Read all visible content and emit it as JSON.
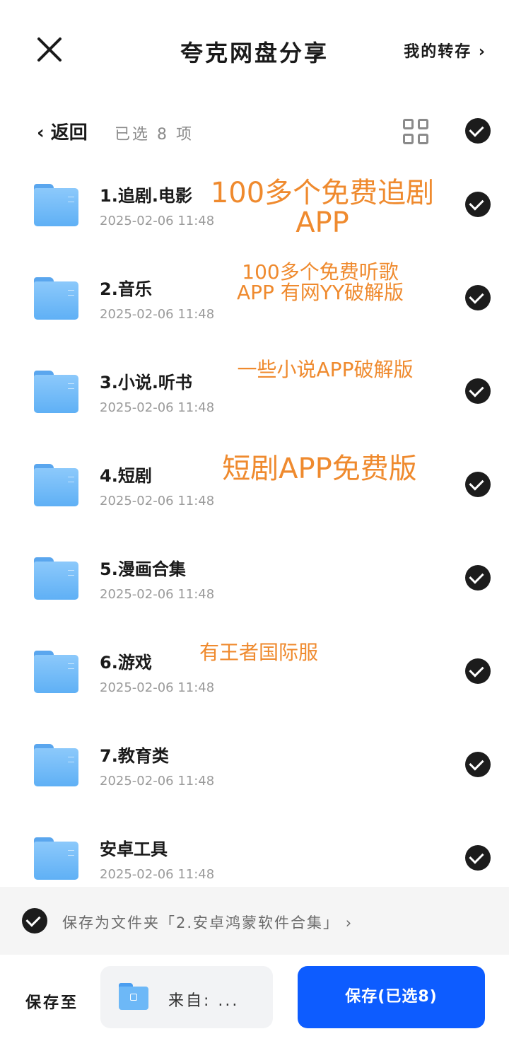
{
  "header": {
    "title": "夸克网盘分享",
    "my_transfer": "我的转存 ›"
  },
  "subbar": {
    "back": "‹ 返回",
    "selected": "已选 8 项"
  },
  "files": [
    {
      "name": "1.追剧.电影",
      "date": "2025-02-06 11:48",
      "note": "100多个免费追剧\nAPP",
      "selected": true
    },
    {
      "name": "2.音乐",
      "date": "2025-02-06 11:48",
      "note": "100多个免费听歌\nAPP 有网YY破解版",
      "selected": true
    },
    {
      "name": "3.小说.听书",
      "date": "2025-02-06 11:48",
      "note": "一些小说APP破解版",
      "selected": true
    },
    {
      "name": "4.短剧",
      "date": "2025-02-06 11:48",
      "note": "短剧APP免费版",
      "selected": true
    },
    {
      "name": "5.漫画合集",
      "date": "2025-02-06 11:48",
      "note": "",
      "selected": true
    },
    {
      "name": "6.游戏",
      "date": "2025-02-06 11:48",
      "note": "有王者国际服",
      "selected": true
    },
    {
      "name": "7.教育类",
      "date": "2025-02-06 11:48",
      "note": "",
      "selected": true
    },
    {
      "name": "安卓工具",
      "date": "2025-02-06 11:48",
      "note": "",
      "selected": true
    }
  ],
  "save_folder_option": {
    "text": "保存为文件夹「2.安卓鸿蒙软件合集」 ›",
    "checked": true
  },
  "bottom": {
    "save_to_label": "保存至",
    "destination": "来自: ...",
    "save_button": "保存(已选8)"
  },
  "colors": {
    "accent": "#0d5cff",
    "note": "#ef8a2e",
    "folder": "#6db8f7"
  }
}
